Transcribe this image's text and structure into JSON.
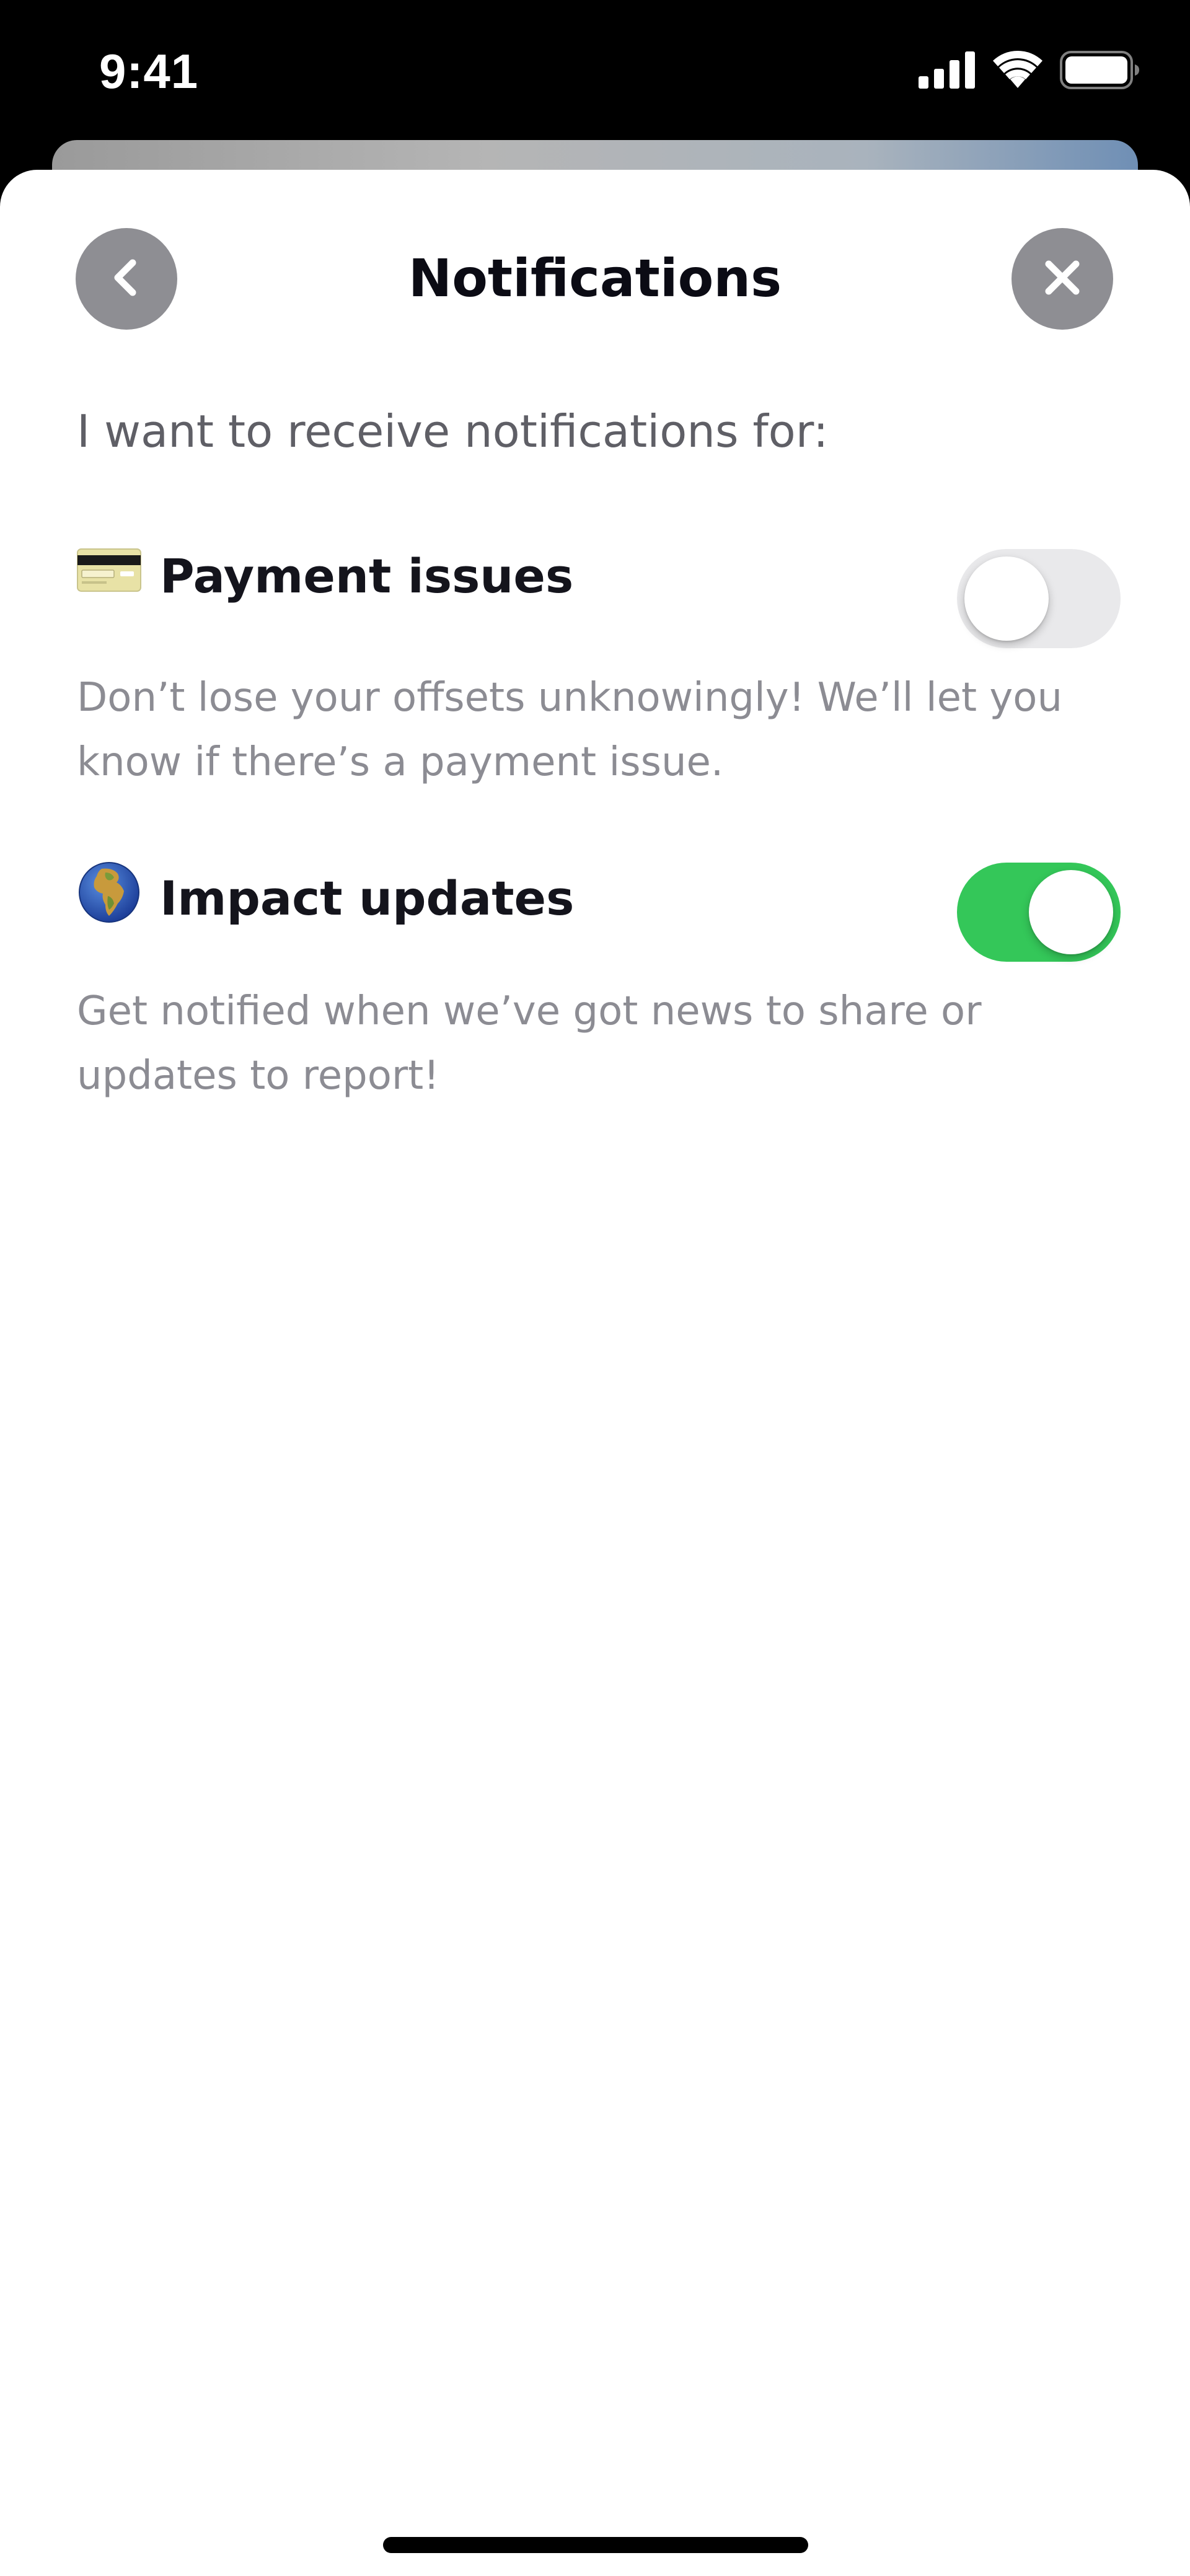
{
  "status_bar": {
    "time": "9:41",
    "icons": [
      "cellular-signal-icon",
      "wifi-icon",
      "battery-icon"
    ]
  },
  "header": {
    "title": "Notifications",
    "back_icon": "chevron-left-icon",
    "close_icon": "close-icon"
  },
  "intro_text": "I want to receive notifications for:",
  "settings": [
    {
      "icon": "credit-card-icon",
      "title": "Payment issues",
      "description": "Don’t lose your offsets unknowingly! We’ll let you know if there’s a payment issue.",
      "enabled": false
    },
    {
      "icon": "globe-africa-icon",
      "title": "Impact updates",
      "description": "Get notified when we’ve got news to share or updates to report!",
      "enabled": true
    }
  ],
  "colors": {
    "toggle_on": "#34c759",
    "toggle_off": "#e9e9eb",
    "nav_button": "#8e8e93"
  }
}
